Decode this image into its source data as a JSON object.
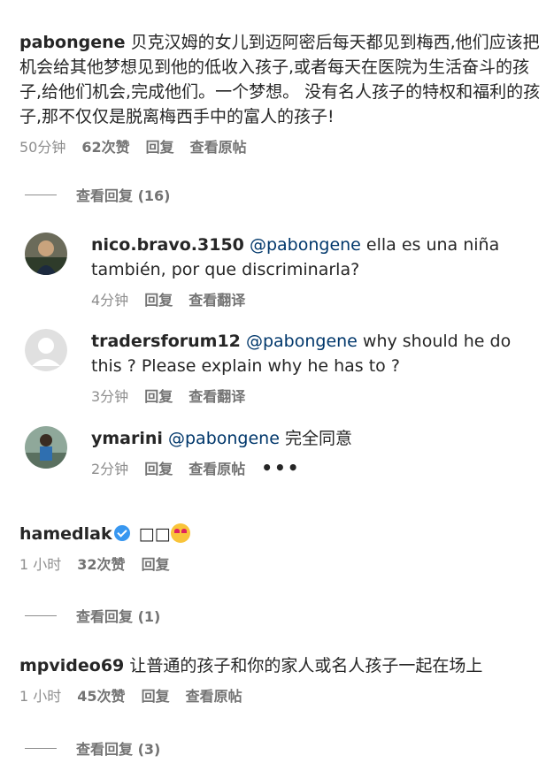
{
  "comments": [
    {
      "username": "pabongene",
      "text": "贝克汉姆的女儿到迈阿密后每天都见到梅西,他们应该把机会给其他梦想见到他的低收入孩子,或者每天在医院为生活奋斗的孩子,给他们机会,完成他们。一个梦想。 没有名人孩子的特权和福利的孩子,那不仅仅是脱离梅西手中的富人的孩子!",
      "time": "50分钟",
      "likes": "62次赞",
      "reply": "回复",
      "action": "查看原帖",
      "view_replies": "查看回复 (16)",
      "replies": [
        {
          "username": "nico.bravo.3150",
          "mention": "@pabongene",
          "text": " ella es una niña también, por que discriminarla?",
          "time": "4分钟",
          "reply": "回复",
          "action": "查看翻译"
        },
        {
          "username": "tradersforum12",
          "mention": "@pabongene",
          "text": " why should he do this ? Please explain why he has to ?",
          "time": "3分钟",
          "reply": "回复",
          "action": "查看翻译"
        },
        {
          "username": "ymarini",
          "mention": "@pabongene",
          "text": " 完全同意",
          "time": "2分钟",
          "reply": "回复",
          "action": "查看原帖",
          "more": "•••"
        }
      ]
    },
    {
      "username": "hamedlak",
      "text": "□□",
      "time": "1 小时",
      "likes": "32次赞",
      "reply": "回复",
      "view_replies": "查看回复 (1)"
    },
    {
      "username": "mpvideo69",
      "text": "让普通的孩子和你的家人或名人孩子一起在场上",
      "time": "1 小时",
      "likes": "45次赞",
      "reply": "回复",
      "action": "查看原帖",
      "view_replies": "查看回复 (3)"
    }
  ],
  "colors": {
    "text": "#262626",
    "mention": "#00376b",
    "meta": "#8e8e8e",
    "verified": "#3897f0"
  }
}
